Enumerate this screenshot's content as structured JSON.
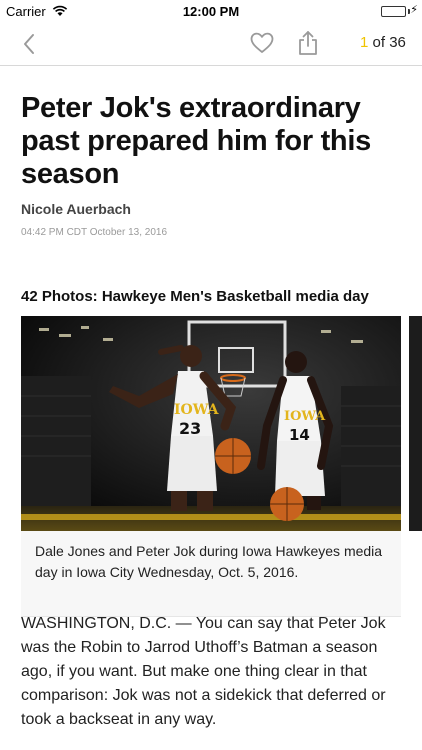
{
  "status": {
    "carrier": "Carrier",
    "time": "12:00 PM",
    "battery_level": 1.0
  },
  "nav": {
    "icons": [
      "back-chevron-icon",
      "heart-icon",
      "share-icon"
    ],
    "counter_current": "1",
    "counter_rest": " of 36"
  },
  "article": {
    "headline": "Peter Jok's extraordinary past prepared him for this season",
    "author": "Nicole Auerbach",
    "timestamp": "04:42 PM CDT October 13, 2016",
    "gallery_title": "42 Photos: Hawkeye Men's Basketball media day",
    "photo_jerseys": [
      "IOWA 23",
      "IOWA 14"
    ],
    "photo_caption": "Dale Jones and Peter Jok during Iowa Hawkeyes media day in Iowa City Wednesday, Oct. 5, 2016.",
    "body": "WASHINGTON, D.C. — You can say that Peter Jok was the Robin to Jarrod Uthoff’s Batman a season ago, if you want. But make one thing clear in that comparison: Jok was not a sidekick that deferred or took a backseat in any way."
  },
  "colors": {
    "accent": "#f0c400",
    "battery": "#4cd964"
  }
}
